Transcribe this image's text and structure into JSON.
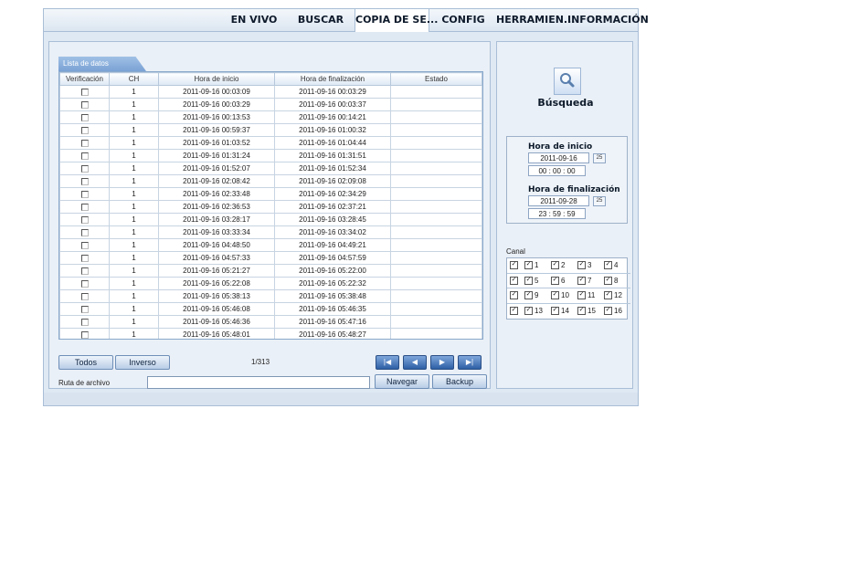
{
  "tabs": [
    {
      "label": "EN VIVO",
      "active": false
    },
    {
      "label": "BUSCAR",
      "active": false
    },
    {
      "label": "COPIA DE SE...",
      "active": true
    },
    {
      "label": "CONFIG",
      "active": false
    },
    {
      "label": "HERRAMIEN...",
      "active": false
    },
    {
      "label": "INFORMACIÓN",
      "active": false
    }
  ],
  "list": {
    "title": "Lista de datos",
    "columns": [
      "Verificación",
      "CH",
      "Hora de inicio",
      "Hora de finalización",
      "Estado"
    ],
    "rows": [
      {
        "ch": "1",
        "start": "2011-09-16 00:03:09",
        "end": "2011-09-16 00:03:29",
        "status": ""
      },
      {
        "ch": "1",
        "start": "2011-09-16 00:03:29",
        "end": "2011-09-16 00:03:37",
        "status": ""
      },
      {
        "ch": "1",
        "start": "2011-09-16 00:13:53",
        "end": "2011-09-16 00:14:21",
        "status": ""
      },
      {
        "ch": "1",
        "start": "2011-09-16 00:59:37",
        "end": "2011-09-16 01:00:32",
        "status": ""
      },
      {
        "ch": "1",
        "start": "2011-09-16 01:03:52",
        "end": "2011-09-16 01:04:44",
        "status": ""
      },
      {
        "ch": "1",
        "start": "2011-09-16 01:31:24",
        "end": "2011-09-16 01:31:51",
        "status": ""
      },
      {
        "ch": "1",
        "start": "2011-09-16 01:52:07",
        "end": "2011-09-16 01:52:34",
        "status": ""
      },
      {
        "ch": "1",
        "start": "2011-09-16 02:08:42",
        "end": "2011-09-16 02:09:08",
        "status": ""
      },
      {
        "ch": "1",
        "start": "2011-09-16 02:33:48",
        "end": "2011-09-16 02:34:29",
        "status": ""
      },
      {
        "ch": "1",
        "start": "2011-09-16 02:36:53",
        "end": "2011-09-16 02:37:21",
        "status": ""
      },
      {
        "ch": "1",
        "start": "2011-09-16 03:28:17",
        "end": "2011-09-16 03:28:45",
        "status": ""
      },
      {
        "ch": "1",
        "start": "2011-09-16 03:33:34",
        "end": "2011-09-16 03:34:02",
        "status": ""
      },
      {
        "ch": "1",
        "start": "2011-09-16 04:48:50",
        "end": "2011-09-16 04:49:21",
        "status": ""
      },
      {
        "ch": "1",
        "start": "2011-09-16 04:57:33",
        "end": "2011-09-16 04:57:59",
        "status": ""
      },
      {
        "ch": "1",
        "start": "2011-09-16 05:21:27",
        "end": "2011-09-16 05:22:00",
        "status": ""
      },
      {
        "ch": "1",
        "start": "2011-09-16 05:22:08",
        "end": "2011-09-16 05:22:32",
        "status": ""
      },
      {
        "ch": "1",
        "start": "2011-09-16 05:38:13",
        "end": "2011-09-16 05:38:48",
        "status": ""
      },
      {
        "ch": "1",
        "start": "2011-09-16 05:46:08",
        "end": "2011-09-16 05:46:35",
        "status": ""
      },
      {
        "ch": "1",
        "start": "2011-09-16 05:46:36",
        "end": "2011-09-16 05:47:16",
        "status": ""
      },
      {
        "ch": "1",
        "start": "2011-09-16 05:48:01",
        "end": "2011-09-16 05:48:27",
        "status": ""
      }
    ]
  },
  "controls": {
    "all_label": "Todos",
    "inverse_label": "Inverso",
    "page": "1/313",
    "path_label": "Ruta de archivo",
    "path_value": "",
    "browse_label": "Navegar",
    "backup_label": "Backup"
  },
  "search": {
    "title": "Búsqueda",
    "start_label": "Hora de inicio",
    "start_date": "2011-09-16",
    "start_time": "00 : 00 : 00",
    "end_label": "Hora de finalización",
    "end_date": "2011-09-28",
    "end_time": "23 : 59 : 59",
    "calendar_label": "25"
  },
  "canal": {
    "label": "Canal",
    "rows": [
      [
        "1",
        "2",
        "3",
        "4"
      ],
      [
        "5",
        "6",
        "7",
        "8"
      ],
      [
        "9",
        "10",
        "11",
        "12"
      ],
      [
        "13",
        "14",
        "15",
        "16"
      ]
    ]
  },
  "icons": {
    "first": "first-page-icon",
    "prev": "prev-page-icon",
    "next": "next-page-icon",
    "last": "last-page-icon",
    "search": "search-icon",
    "calendar": "calendar-icon"
  },
  "colors": {
    "accent": "#2e5fa5",
    "panel": "#eaf0f7",
    "border": "#a9bed6"
  }
}
